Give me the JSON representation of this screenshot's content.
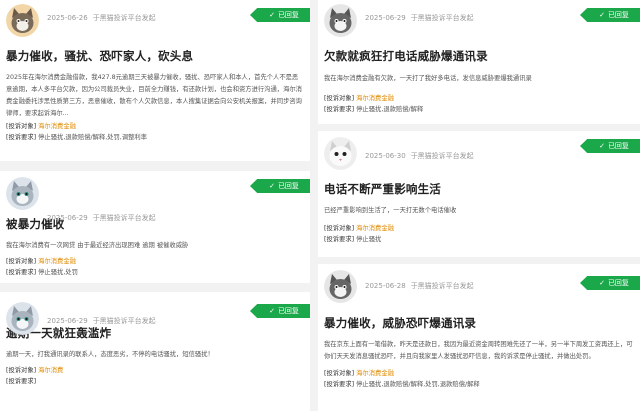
{
  "source_suffix": "于黑猫投诉平台发起",
  "badge_label": "已回复",
  "target_key": "[投诉对象]",
  "request_key": "[投诉要求]",
  "accent": "#1aa84a",
  "target_color": "#e08a00",
  "cards": [
    {
      "date": "2025-06-26",
      "avatar": "cat-avatar-brown",
      "title": "暴力催收，骚扰、恐吓家人，砍头息",
      "body": "2025年在海尔消费金融借款，我427.8元逾期三天被暴力催收，骚扰、恐吓家人和本人，首先个人不是恶意逾期，本人多平台欠款，因为公司裁员失业，目前全力赚钱，有还款计划，也会和资方进行沟通，海尔消费金融委托涉黑性质第三方，恶意催收，散布个人欠款信息，本人搜集证据会向公安机关报案，并同步咨询律师，要求起诉海尔...",
      "target": "海尔消费金融",
      "request": "停止骚扰,退款赔偿/解释,处罚,调整利率"
    },
    {
      "date": "2025-06-29",
      "avatar": "cat-avatar-grey",
      "title": "被暴力催收",
      "body": "我在海尔消费有一次网贷 由于最近经济出现困难 逾期 被催收威胁",
      "target": "海尔消费金融",
      "request": "停止骚扰,处罚"
    },
    {
      "date": "2025-06-29",
      "avatar": "cat-avatar-grey",
      "title": "逾期一天就狂轰滥炸",
      "body": "逾期一天，打我通讯录的联系人，态度恶劣，不停的电话骚扰，短信骚扰！",
      "target": "海尔消费",
      "request": ""
    },
    {
      "date": "2025-06-29",
      "avatar": "cat-avatar-grey",
      "title": "欠款就疯狂打电话威胁爆通讯录",
      "body": "我在海尔消费金融有欠款，一天打了我好多电话，发信息威胁要爆我通讯录",
      "target": "海尔消费金融",
      "request": "停止骚扰,退款赔偿/解释"
    },
    {
      "date": "2025-06-30",
      "avatar": "cat-avatar-white",
      "title": "电话不断严重影响生活",
      "body": "已经严重影响到生活了，一天打无数个电话催收",
      "target": "海尔消费金融",
      "request": "停止骚扰"
    },
    {
      "date": "2025-06-28",
      "avatar": "cat-avatar-grey",
      "title": "暴力催收，威胁恐吓爆通讯录",
      "body": "我在京东上面有一笔借款，昨天是还款日，我因为最近资金周转困难先还了一半，另一半下周发工资再还上，可你们天天发消息骚扰恐吓，并且向我家里人发骚扰恐吓信息，我的诉求是停止骚扰，并做出处罚。",
      "target": "海尔消费金融",
      "request": "停止骚扰,退款赔偿/解释,处罚,退款赔偿/解释"
    }
  ]
}
